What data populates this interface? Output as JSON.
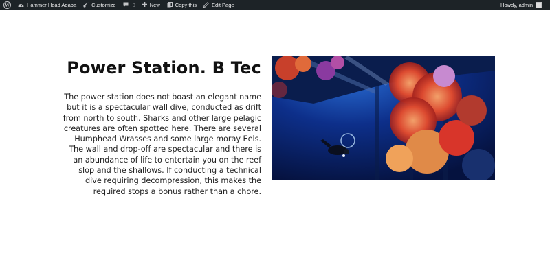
{
  "adminbar": {
    "site_name": "Hammer Head Aqaba",
    "customize": "Customize",
    "comments_count": "0",
    "new": "New",
    "copy": "Copy this",
    "edit_page": "Edit Page",
    "howdy": "Howdy, admin"
  },
  "page": {
    "title": "Power Station. B Tec",
    "description": "The power station does not boast an elegant name but it is a spectacular wall dive, conducted as drift from north to south. Sharks and other large pelagic creatures are often spotted here. There are several Humphead Wrasses and some large moray Eels. The wall and drop-off are spectacular and there is an abundance of life to entertain you on the reef slop and the shallows. If conducting a technical dive requiring decompression, this makes the required stops a bonus rather than a chore."
  },
  "colors": {
    "adminbar_bg": "#1d2327",
    "water": "#0b2a7a",
    "coral_red": "#d8352a",
    "coral_orange": "#e58a3a"
  },
  "icons": [
    "wordpress-logo-icon",
    "dashboard-icon",
    "customize-brush-icon",
    "comment-icon",
    "plus-icon",
    "copy-icon",
    "edit-pencil-icon",
    "avatar"
  ]
}
